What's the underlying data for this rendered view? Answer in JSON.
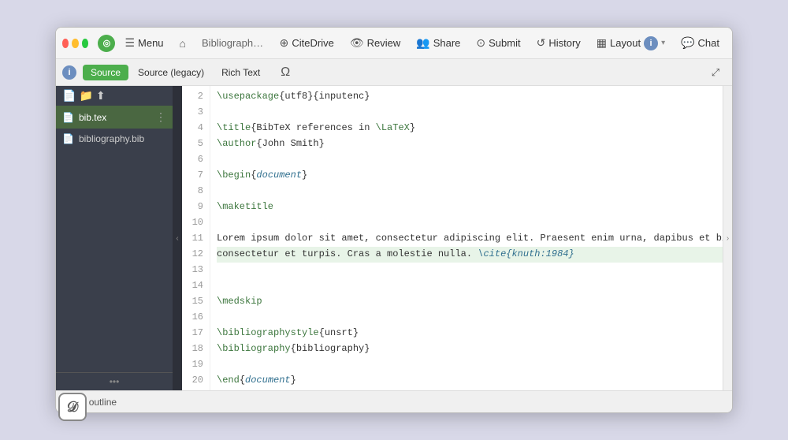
{
  "window": {
    "title": "Bibliography man..."
  },
  "titlebar": {
    "menu_label": "Menu",
    "home_icon": "🏠",
    "citedrive_label": "CiteDrive",
    "review_label": "Review",
    "share_label": "Share",
    "submit_label": "Submit",
    "history_label": "History",
    "layout_label": "Layout",
    "chat_label": "Chat"
  },
  "toolbar": {
    "source_tab": "Source",
    "source_legacy_tab": "Source (legacy)",
    "rich_text_tab": "Rich Text"
  },
  "sidebar": {
    "files": [
      {
        "name": "bib.tex",
        "active": true
      },
      {
        "name": "bibliography.bib",
        "active": false
      }
    ],
    "file_outline_label": "File outline"
  },
  "editor": {
    "lines": [
      {
        "num": 2,
        "content": "\\usepackage{utf8}{inputenc}",
        "type": "command"
      },
      {
        "num": 3,
        "content": "",
        "type": "normal"
      },
      {
        "num": 4,
        "content": "\\title{BibTeX references in \\LaTeX}",
        "type": "command"
      },
      {
        "num": 5,
        "content": "\\author{John Smith}",
        "type": "command"
      },
      {
        "num": 6,
        "content": "",
        "type": "normal"
      },
      {
        "num": 7,
        "content": "\\begin{document}",
        "type": "command"
      },
      {
        "num": 8,
        "content": "",
        "type": "normal"
      },
      {
        "num": 9,
        "content": "\\maketitle",
        "type": "command"
      },
      {
        "num": 10,
        "content": "",
        "type": "normal"
      },
      {
        "num": 11,
        "content": "Lorem ipsum dolor sit amet, consectetur adipiscing elit. Praesent enim urna, dapibus et bibendum vel,",
        "type": "normal"
      },
      {
        "num": 12,
        "content": "consectetur et turpis. Cras a molestie nulla. \\cite{knuth:1984}",
        "type": "highlighted"
      },
      {
        "num": 13,
        "content": "",
        "type": "normal"
      },
      {
        "num": 14,
        "content": "",
        "type": "normal"
      },
      {
        "num": 15,
        "content": "\\medskip",
        "type": "command"
      },
      {
        "num": 16,
        "content": "",
        "type": "normal"
      },
      {
        "num": 17,
        "content": "\\bibliographystyle{unsrt}",
        "type": "command"
      },
      {
        "num": 18,
        "content": "\\bibliography{bibliography}",
        "type": "command"
      },
      {
        "num": 19,
        "content": "",
        "type": "normal"
      },
      {
        "num": 20,
        "content": "\\end{document}",
        "type": "command"
      }
    ]
  }
}
